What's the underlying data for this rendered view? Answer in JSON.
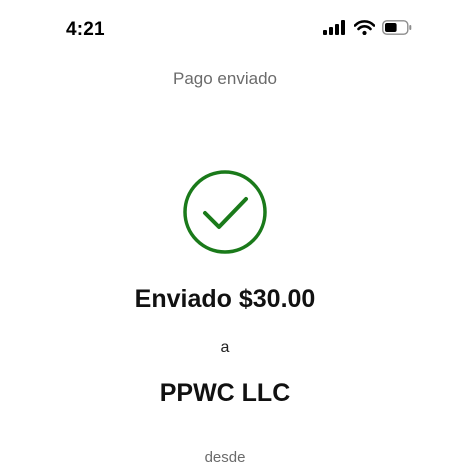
{
  "status_bar": {
    "time": "4:21",
    "icons": [
      "cellular-signal-icon",
      "wifi-icon",
      "battery-icon"
    ],
    "battery_level": 0.55
  },
  "header": {
    "title": "Pago enviado"
  },
  "confirmation": {
    "icon": "checkmark-circle-icon",
    "icon_color": "#1a7a1a",
    "amount_text": "Enviado $30.00",
    "to_label": "a",
    "recipient": "PPWC LLC",
    "from_label": "desde"
  }
}
